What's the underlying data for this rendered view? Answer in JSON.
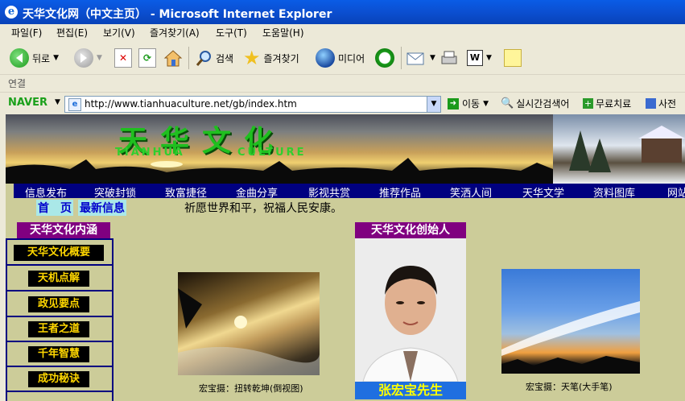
{
  "window": {
    "title": "天华文化网（中文主页） - Microsoft Internet Explorer"
  },
  "menu": [
    "파일(F)",
    "편집(E)",
    "보기(V)",
    "즐겨찾기(A)",
    "도구(T)",
    "도움말(H)"
  ],
  "toolbar": {
    "back": "뒤로",
    "search": "검색",
    "favorites": "즐겨찾기",
    "media": "미디어"
  },
  "links_label": "연결",
  "naver": {
    "logo": "NAVER",
    "url": "http://www.tianhuaculture.net/gb/index.htm",
    "go": "이동",
    "realtime": "실시간검색어",
    "free": "무료치료",
    "dict": "사전"
  },
  "banner": {
    "title": "天华文化",
    "sub_left": "TIANHUA",
    "sub_right": "CULTURE"
  },
  "nav": [
    "信息发布",
    "突破封锁",
    "致富捷径",
    "金曲分享",
    "影视共赏",
    "推荐作品",
    "笑洒人间",
    "天华文学",
    "资料图库",
    "网站"
  ],
  "row2": {
    "home": "首　页",
    "news": "最新信息",
    "motto": "祈愿世界和平，祝福人民安康。"
  },
  "left": {
    "heading": "天华文化内涵",
    "items": [
      "天华文化概要",
      "天机点解",
      "政见要点",
      "王者之道",
      "千年智慧",
      "成功秘诀"
    ]
  },
  "founder": {
    "heading": "天华文化创始人",
    "name": "张宏宝先生"
  },
  "captions": {
    "photo1": "宏宝摄：扭转乾坤(倒视图)",
    "photo2": "宏宝摄：天笔(大手笔)"
  }
}
